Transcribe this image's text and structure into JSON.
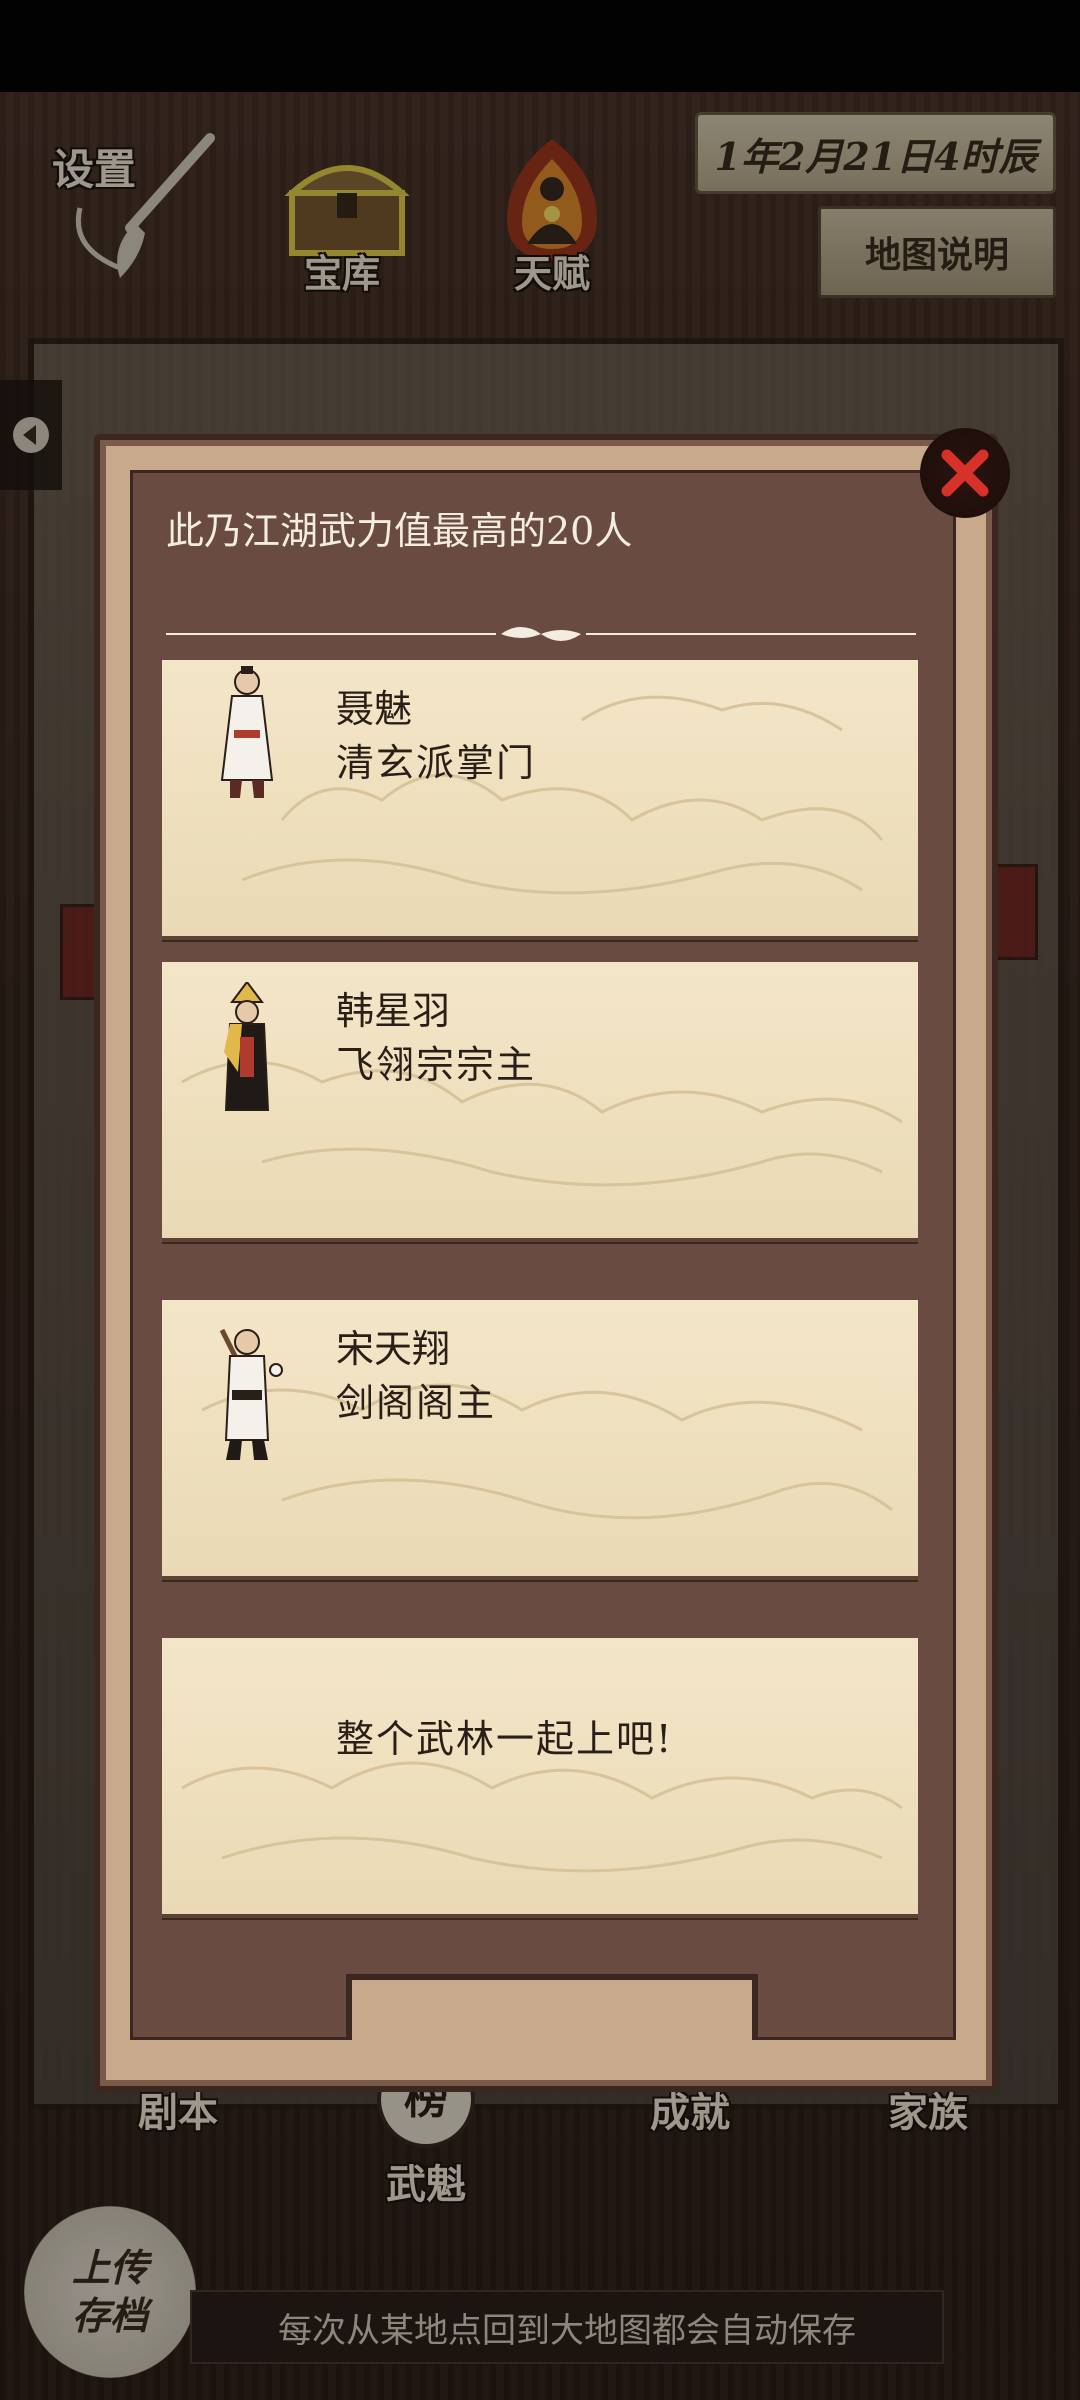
{
  "top": {
    "settings_label": "设置",
    "treasury_label": "宝库",
    "talent_label": "天赋",
    "date": "1年2月21日4时辰",
    "map_help": "地图说明"
  },
  "dialog": {
    "title": "此乃江湖武力值最高的20人",
    "entries": [
      {
        "name": "聂魅",
        "role": "清玄派掌门"
      },
      {
        "name": "韩星羽",
        "role": "飞翎宗宗主"
      },
      {
        "name": "宋天翔",
        "role": "剑阁阁主"
      },
      {
        "text": "整个武林一起上吧!"
      }
    ]
  },
  "nav": {
    "script": "剧本",
    "champion": "武魁",
    "champion_badge": "榜",
    "achievement": "成就",
    "family": "家族"
  },
  "save": {
    "upload_line1": "上传",
    "upload_line2": "存档",
    "tip": "每次从某地点回到大地图都会自动保存"
  },
  "colors": {
    "parchment": "#f3e6c8",
    "dialog_bg": "#6a4b42",
    "close_x": "#d7322a"
  }
}
